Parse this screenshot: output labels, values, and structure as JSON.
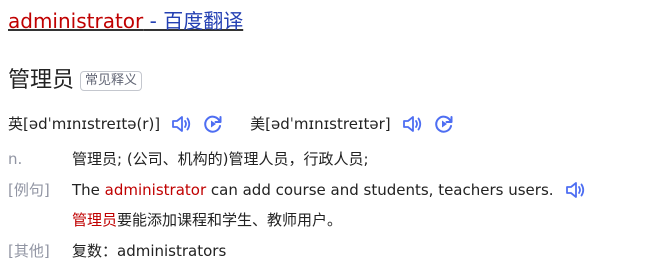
{
  "title": {
    "keyword": "administrator",
    "rest": " - 百度翻译"
  },
  "headword": {
    "word": "管理员",
    "tag": "常见释义"
  },
  "pronunciation": [
    {
      "label": "英[ədˈmɪnɪstreɪtə(r)]"
    },
    {
      "label": "美[ədˈmɪnɪstreɪtər]"
    }
  ],
  "definition": {
    "pos": "n.",
    "meaning": "管理员; (公司、机构的)管理人员，行政人员;"
  },
  "example": {
    "label": "[例句]",
    "en_before": "The ",
    "en_keyword": "administrator",
    "en_after": " can add course and students, teachers users.",
    "cn_keyword": "管理员",
    "cn_after": "要能添加课程和学生、教师用户。"
  },
  "other": {
    "label": "[其他]",
    "text": "复数：administrators"
  },
  "icons": {
    "speaker": "speaker-icon",
    "replay": "replay-icon"
  },
  "colors": {
    "link_blue": "#2440b3",
    "highlight_red": "#c00000",
    "icon_blue": "#4e6ef2",
    "label_gray": "#9195a3"
  }
}
